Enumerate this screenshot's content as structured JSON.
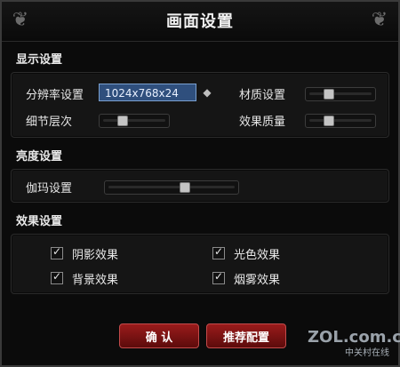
{
  "window": {
    "title": "画面设置"
  },
  "sections": {
    "display": {
      "title": "显示设置",
      "resolution_label": "分辨率设置",
      "resolution_value": "1024x768x24",
      "detail_label": "细节层次",
      "material_label": "材质设置",
      "effect_quality_label": "效果质量"
    },
    "brightness": {
      "title": "亮度设置",
      "gamma_label": "伽玛设置"
    },
    "effects": {
      "title": "效果设置",
      "options": [
        {
          "label": "阴影效果",
          "checked": true
        },
        {
          "label": "光色效果",
          "checked": true
        },
        {
          "label": "背景效果",
          "checked": true
        },
        {
          "label": "烟雾效果",
          "checked": true
        }
      ]
    }
  },
  "buttons": {
    "ok": "确 认",
    "recommended": "推荐配置"
  },
  "watermark": {
    "domain": "ZOL.com.cn",
    "subtitle": "中关村在线"
  },
  "sliders": {
    "detail_level": 0.3,
    "material_level": 0.3,
    "effect_quality_level": 0.3,
    "gamma_level": 0.6
  },
  "icons": {
    "corner_ornament": "corner-ornament-icon",
    "dropdown_arrow": "diamond-arrow-icon",
    "checkbox_check": "check-icon"
  }
}
